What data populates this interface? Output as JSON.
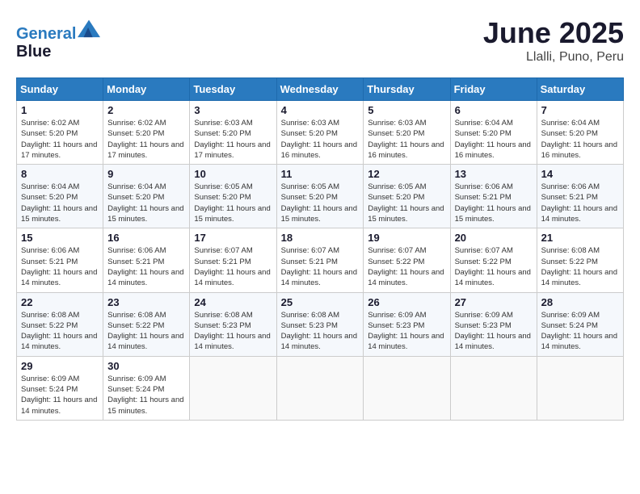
{
  "header": {
    "logo_line1": "General",
    "logo_line2": "Blue",
    "title": "June 2025",
    "subtitle": "Llalli, Puno, Peru"
  },
  "calendar": {
    "days_of_week": [
      "Sunday",
      "Monday",
      "Tuesday",
      "Wednesday",
      "Thursday",
      "Friday",
      "Saturday"
    ],
    "weeks": [
      [
        null,
        {
          "day": 2,
          "sunrise": "6:02 AM",
          "sunset": "5:20 PM",
          "daylight": "11 hours and 17 minutes."
        },
        {
          "day": 3,
          "sunrise": "6:03 AM",
          "sunset": "5:20 PM",
          "daylight": "11 hours and 17 minutes."
        },
        {
          "day": 4,
          "sunrise": "6:03 AM",
          "sunset": "5:20 PM",
          "daylight": "11 hours and 16 minutes."
        },
        {
          "day": 5,
          "sunrise": "6:03 AM",
          "sunset": "5:20 PM",
          "daylight": "11 hours and 16 minutes."
        },
        {
          "day": 6,
          "sunrise": "6:04 AM",
          "sunset": "5:20 PM",
          "daylight": "11 hours and 16 minutes."
        },
        {
          "day": 7,
          "sunrise": "6:04 AM",
          "sunset": "5:20 PM",
          "daylight": "11 hours and 16 minutes."
        }
      ],
      [
        {
          "day": 1,
          "sunrise": "6:02 AM",
          "sunset": "5:20 PM",
          "daylight": "11 hours and 17 minutes."
        },
        {
          "day": 9,
          "sunrise": "6:04 AM",
          "sunset": "5:20 PM",
          "daylight": "11 hours and 15 minutes."
        },
        {
          "day": 10,
          "sunrise": "6:05 AM",
          "sunset": "5:20 PM",
          "daylight": "11 hours and 15 minutes."
        },
        {
          "day": 11,
          "sunrise": "6:05 AM",
          "sunset": "5:20 PM",
          "daylight": "11 hours and 15 minutes."
        },
        {
          "day": 12,
          "sunrise": "6:05 AM",
          "sunset": "5:20 PM",
          "daylight": "11 hours and 15 minutes."
        },
        {
          "day": 13,
          "sunrise": "6:06 AM",
          "sunset": "5:21 PM",
          "daylight": "11 hours and 15 minutes."
        },
        {
          "day": 14,
          "sunrise": "6:06 AM",
          "sunset": "5:21 PM",
          "daylight": "11 hours and 14 minutes."
        }
      ],
      [
        {
          "day": 8,
          "sunrise": "6:04 AM",
          "sunset": "5:20 PM",
          "daylight": "11 hours and 15 minutes."
        },
        {
          "day": 16,
          "sunrise": "6:06 AM",
          "sunset": "5:21 PM",
          "daylight": "11 hours and 14 minutes."
        },
        {
          "day": 17,
          "sunrise": "6:07 AM",
          "sunset": "5:21 PM",
          "daylight": "11 hours and 14 minutes."
        },
        {
          "day": 18,
          "sunrise": "6:07 AM",
          "sunset": "5:21 PM",
          "daylight": "11 hours and 14 minutes."
        },
        {
          "day": 19,
          "sunrise": "6:07 AM",
          "sunset": "5:22 PM",
          "daylight": "11 hours and 14 minutes."
        },
        {
          "day": 20,
          "sunrise": "6:07 AM",
          "sunset": "5:22 PM",
          "daylight": "11 hours and 14 minutes."
        },
        {
          "day": 21,
          "sunrise": "6:08 AM",
          "sunset": "5:22 PM",
          "daylight": "11 hours and 14 minutes."
        }
      ],
      [
        {
          "day": 15,
          "sunrise": "6:06 AM",
          "sunset": "5:21 PM",
          "daylight": "11 hours and 14 minutes."
        },
        {
          "day": 23,
          "sunrise": "6:08 AM",
          "sunset": "5:22 PM",
          "daylight": "11 hours and 14 minutes."
        },
        {
          "day": 24,
          "sunrise": "6:08 AM",
          "sunset": "5:23 PM",
          "daylight": "11 hours and 14 minutes."
        },
        {
          "day": 25,
          "sunrise": "6:08 AM",
          "sunset": "5:23 PM",
          "daylight": "11 hours and 14 minutes."
        },
        {
          "day": 26,
          "sunrise": "6:09 AM",
          "sunset": "5:23 PM",
          "daylight": "11 hours and 14 minutes."
        },
        {
          "day": 27,
          "sunrise": "6:09 AM",
          "sunset": "5:23 PM",
          "daylight": "11 hours and 14 minutes."
        },
        {
          "day": 28,
          "sunrise": "6:09 AM",
          "sunset": "5:24 PM",
          "daylight": "11 hours and 14 minutes."
        }
      ],
      [
        {
          "day": 22,
          "sunrise": "6:08 AM",
          "sunset": "5:22 PM",
          "daylight": "11 hours and 14 minutes."
        },
        {
          "day": 30,
          "sunrise": "6:09 AM",
          "sunset": "5:24 PM",
          "daylight": "11 hours and 15 minutes."
        },
        null,
        null,
        null,
        null,
        null
      ],
      [
        {
          "day": 29,
          "sunrise": "6:09 AM",
          "sunset": "5:24 PM",
          "daylight": "11 hours and 14 minutes."
        },
        null,
        null,
        null,
        null,
        null,
        null
      ]
    ]
  }
}
